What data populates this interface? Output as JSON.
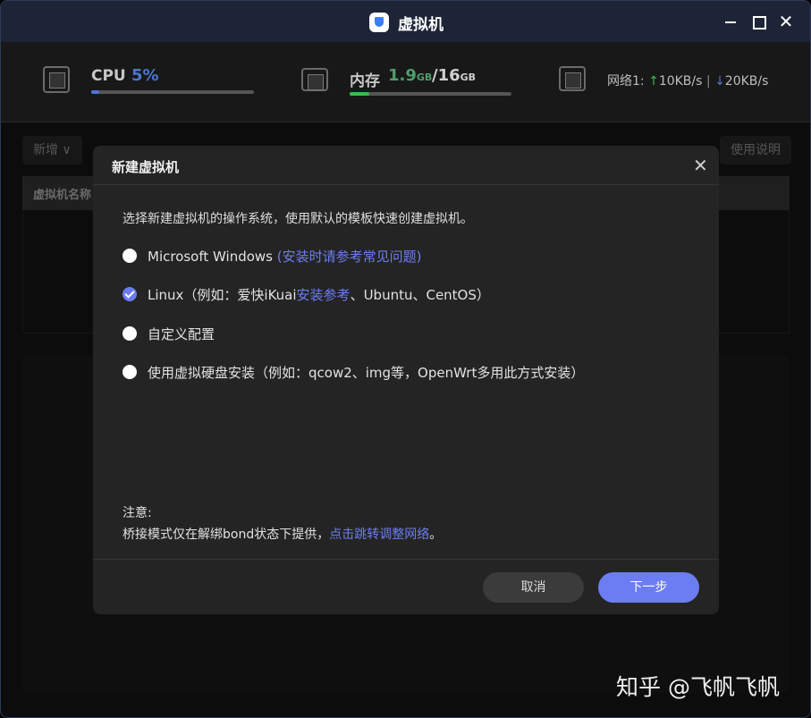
{
  "window": {
    "title": "虚拟机"
  },
  "stats": {
    "cpu": {
      "label": "CPU",
      "value": "5%",
      "usage": 0.05
    },
    "memory": {
      "label": "内存",
      "used": "1.9",
      "used_unit": "GB",
      "slash": "/",
      "total": "16",
      "total_unit": "GB",
      "usage": 0.12
    },
    "network": {
      "label": "网络1:",
      "up_arrow": "↑",
      "up": "10KB/s",
      "separator": "|",
      "down_arrow": "↓",
      "down": "20KB/s"
    }
  },
  "toolbar": {
    "add_label": "新增 ∨",
    "help_label": "使用说明"
  },
  "table": {
    "header_first": "虚拟机名称"
  },
  "modal": {
    "title": "新建虚拟机",
    "close": "✕",
    "intro": "选择新建虚拟机的操作系统，使用默认的模板快速创建虚拟机。",
    "options": [
      {
        "text": "Microsoft Windows ",
        "link": "(安装时请参考常见问题)",
        "suffix": "",
        "checked": false
      },
      {
        "text": "Linux（例如：爱快iKuai",
        "link": "安装参考",
        "suffix": "、Ubuntu、CentOS）",
        "checked": true
      },
      {
        "text": "自定义配置",
        "link": "",
        "suffix": "",
        "checked": false
      },
      {
        "text": "使用虚拟硬盘安装（例如：qcow2、img等，OpenWrt多用此方式安装）",
        "link": "",
        "suffix": "",
        "checked": false
      }
    ],
    "note_title": "注意:",
    "note_text": "桥接模式仅在解绑bond状态下提供，",
    "note_link": "点击跳转调整网络",
    "note_end": "。",
    "cancel_label": "取消",
    "next_label": "下一步"
  },
  "watermark": "知乎 @飞帆飞帆",
  "colors": {
    "accent": "#6c7df2",
    "cpu_bar": "#4c77cf",
    "mem_bar": "#3fb94e"
  }
}
